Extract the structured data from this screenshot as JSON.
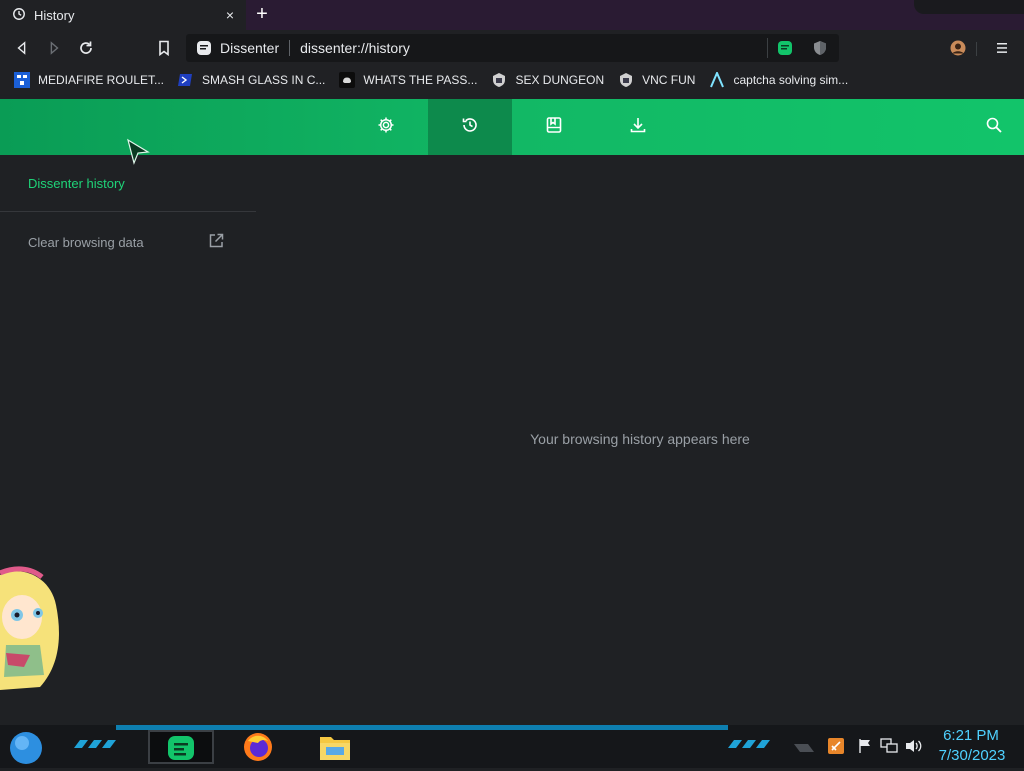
{
  "tab": {
    "title": "History",
    "close_glyph": "×",
    "new_tab_glyph": "+"
  },
  "toolbar": {
    "site_label": "Dissenter",
    "url": "dissenter://history"
  },
  "bookmarks": [
    {
      "label": "MEDIAFIRE ROULET...",
      "icon": "mediafire-icon",
      "icon_text": "MF\nT"
    },
    {
      "label": "SMASH GLASS IN C...",
      "icon": "powershell-icon",
      "icon_text": ""
    },
    {
      "label": "WHATS THE PASS...",
      "icon": "discord-icon",
      "icon_text": ""
    },
    {
      "label": "SEX DUNGEON",
      "icon": "shield-emblem-icon",
      "icon_text": ""
    },
    {
      "label": "VNC FUN",
      "icon": "shield-emblem-icon",
      "icon_text": ""
    },
    {
      "label": "captcha solving sim...",
      "icon": "arc-icon",
      "icon_text": ""
    }
  ],
  "header_nav": [
    {
      "name": "settings",
      "active": false
    },
    {
      "name": "history",
      "active": true
    },
    {
      "name": "bookmarks",
      "active": false
    },
    {
      "name": "downloads",
      "active": false
    }
  ],
  "sidebar": {
    "title": "Dissenter history",
    "clear_label": "Clear browsing data"
  },
  "main": {
    "empty_message": "Your browsing history appears here"
  },
  "taskbar": {
    "time": "6:21 PM",
    "date": "7/30/2023"
  },
  "colors": {
    "accent": "#12c46a",
    "header_active": "#0d8a4c",
    "sidebar_title": "#1ed378",
    "clock": "#4fd1ff"
  }
}
